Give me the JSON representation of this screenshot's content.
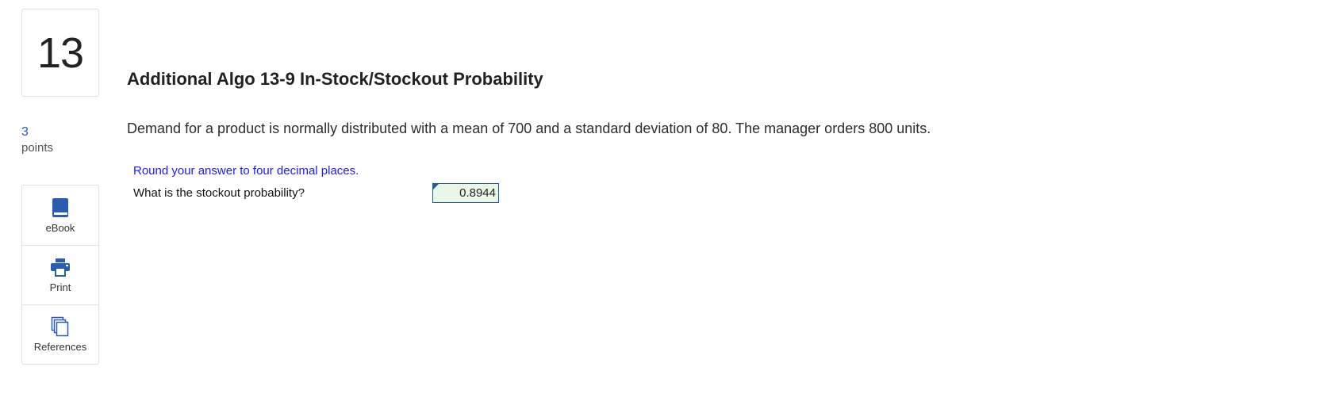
{
  "question": {
    "number": "13",
    "points_value": "3",
    "points_label": "points",
    "title": "Additional Algo 13-9 In-Stock/Stockout Probability",
    "prompt": "Demand for a product is normally distributed with a mean of 700 and a standard deviation of 80. The manager orders 800 units.",
    "instruction": "Round your answer to four decimal places.",
    "sub_question": "What is the stockout probability?",
    "answer_value": "0.8944"
  },
  "tools": {
    "ebook_label": "eBook",
    "ebook_icon": "book-icon",
    "print_label": "Print",
    "print_icon": "printer-icon",
    "references_label": "References",
    "references_icon": "documents-icon"
  },
  "colors": {
    "accent": "#2a5db0",
    "instruction": "#1a1aff",
    "answer_fill": "#eaf6e8",
    "answer_border": "#1e5aa8"
  }
}
